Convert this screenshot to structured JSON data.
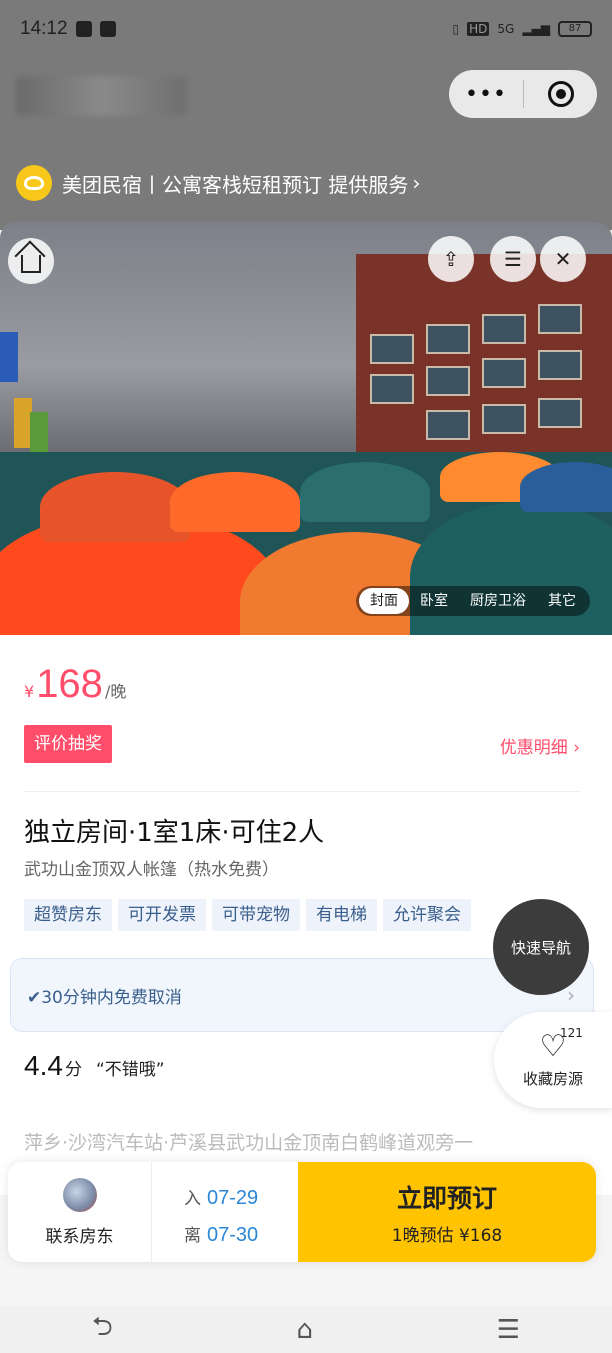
{
  "status_bar": {
    "time": "14:12",
    "network": "5G",
    "battery": "87"
  },
  "mini_program": {
    "brand_text": "美团民宿丨公寓客栈短租预订 提供服务",
    "more_dots": "•••"
  },
  "gallery": {
    "categories": [
      "封面",
      "卧室",
      "厨房卫浴",
      "其它"
    ],
    "active_category": "封面"
  },
  "price": {
    "currency": "¥",
    "amount": "168",
    "unit": "/晚"
  },
  "promo": {
    "lottery_label": "评价抽奖",
    "discount_label": "优惠明细 ›"
  },
  "room": {
    "title": "独立房间·1室1床·可住2人",
    "subtitle": "武功山金顶双人帐篷（热水免费）",
    "tags": [
      "超赞房东",
      "可开发票",
      "可带宠物",
      "有电梯",
      "允许聚会"
    ]
  },
  "cancel_policy": {
    "text": "✔30分钟内免费取消",
    "chevron": "›"
  },
  "rating": {
    "score": "4.4",
    "unit": "分",
    "quote": "“不错哦”"
  },
  "address": "萍乡·沙湾汽车站·芦溪县武功山金顶南白鹤峰道观旁一",
  "floating": {
    "quick_nav": "快速导航",
    "favorite_count": "121",
    "favorite_label": "收藏房源"
  },
  "booking_bar": {
    "contact_label": "联系房东",
    "checkin_label": "入",
    "checkin_date": "07-29",
    "checkout_label": "离",
    "checkout_date": "07-30",
    "book_title": "立即预订",
    "book_subtitle": "1晚预估 ¥168"
  },
  "colors": {
    "accent": "#ff4d6a",
    "book_yellow": "#ffc300",
    "tag_blue": "#3b5f8c",
    "date_blue": "#2b87d6"
  }
}
